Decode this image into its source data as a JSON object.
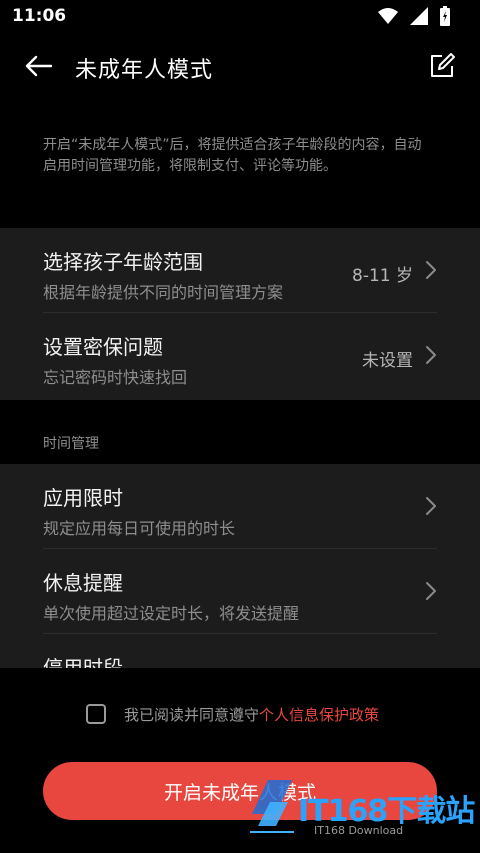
{
  "status": {
    "time": "11:06"
  },
  "app_bar": {
    "title": "未成年人模式"
  },
  "intro": "开启“未成年人模式”后，将提供适合孩子年龄段的内容，自动启用时间管理功能，将限制支付、评论等功能。",
  "card1": {
    "rows": [
      {
        "title": "选择孩子年龄范围",
        "sub": "根据年龄提供不同的时间管理方案",
        "value": "8-11 岁"
      },
      {
        "title": "设置密保问题",
        "sub": "忘记密码时快速找回",
        "value": "未设置"
      }
    ]
  },
  "section_header": "时间管理",
  "card2": {
    "rows": [
      {
        "title": "应用限时",
        "sub": "规定应用每日可使用的时长"
      },
      {
        "title": "休息提醒",
        "sub": "单次使用超过设定时长，将发送提醒"
      },
      {
        "title": "停用时段",
        "sub": ""
      }
    ]
  },
  "agreement": {
    "text": "我已阅读并同意遵守",
    "link": "个人信息保护政策"
  },
  "primary_button": "开启未成年人模式",
  "watermark": {
    "text": "IT168下载站",
    "sub": "IT168 Download"
  },
  "colors": {
    "accent": "#e8473f",
    "card": "#1c1c1c",
    "background": "#000000"
  }
}
